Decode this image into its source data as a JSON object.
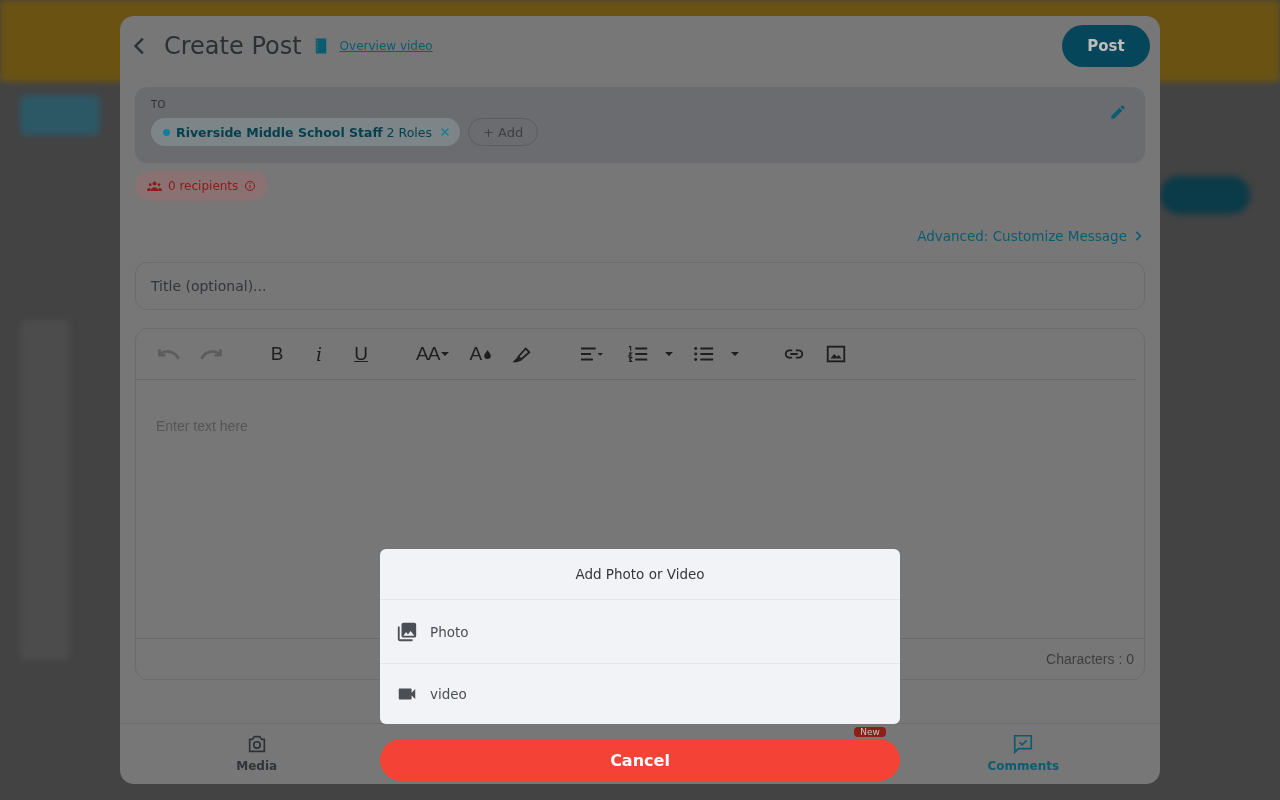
{
  "header": {
    "title": "Create Post",
    "video_link": "Overview video",
    "post_button": "Post"
  },
  "recipients": {
    "label": "TO",
    "chips": [
      {
        "name": "Riverside Middle School Staff",
        "detail": "2 Roles",
        "color": "#0e7f98"
      }
    ],
    "add_button": "+ Add"
  },
  "recipient_count": "0 recipients",
  "advanced_link": "Advanced: Customize Message",
  "title_field": {
    "placeholder": "Title (optional)..."
  },
  "editor": {
    "toolbar": [
      {
        "kind": "undo",
        "disabled": true
      },
      {
        "kind": "redo",
        "disabled": true
      },
      {
        "kind": "bold",
        "glyph": "B"
      },
      {
        "kind": "italic",
        "glyph": "i"
      },
      {
        "kind": "underline",
        "glyph": "U"
      },
      {
        "kind": "size",
        "glyph": "AA"
      },
      {
        "kind": "color",
        "glyph": "A"
      },
      {
        "kind": "highlight"
      },
      {
        "kind": "align"
      },
      {
        "kind": "ordered"
      },
      {
        "kind": "bullets"
      },
      {
        "kind": "link"
      },
      {
        "kind": "image"
      }
    ],
    "placeholder": "Enter text here",
    "char_count": "Characters : 0"
  },
  "bottom_tabs": [
    {
      "kind": "media",
      "label": "Media",
      "selected": false
    },
    {
      "kind": "new",
      "badge": "New"
    },
    {
      "kind": "comments",
      "label": "Comments",
      "selected": true
    }
  ],
  "action_sheet": {
    "title": "Add Photo or Video",
    "options": [
      {
        "kind": "photo",
        "label": "Photo"
      },
      {
        "kind": "video",
        "label": "video"
      }
    ],
    "cancel": "Cancel"
  }
}
